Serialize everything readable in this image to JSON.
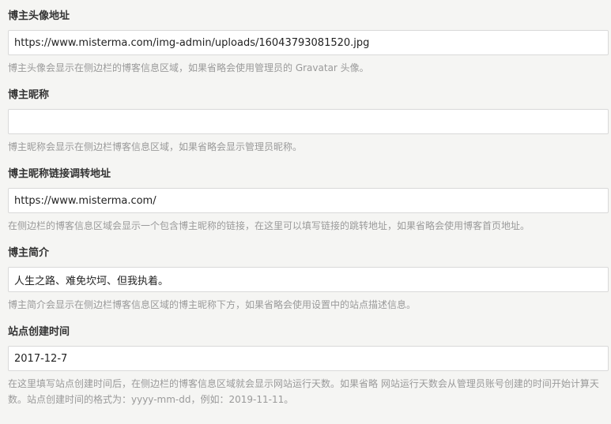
{
  "fields": [
    {
      "label": "博主头像地址",
      "value": "https://www.misterma.com/img-admin/uploads/16043793081520.jpg",
      "help": "博主头像会显示在侧边栏的博客信息区域，如果省略会使用管理员的 Gravatar 头像。"
    },
    {
      "label": "博主昵称",
      "value": "",
      "help": "博主昵称会显示在侧边栏博客信息区域，如果省略会显示管理员昵称。"
    },
    {
      "label": "博主昵称链接调转地址",
      "value": "https://www.misterma.com/",
      "help": "在侧边栏的博客信息区域会显示一个包含博主昵称的链接，在这里可以填写链接的跳转地址，如果省略会使用博客首页地址。"
    },
    {
      "label": "博主简介",
      "value": "人生之路、难免坎坷、但我执着。",
      "help": "博主简介会显示在侧边栏博客信息区域的博主昵称下方，如果省略会使用设置中的站点描述信息。"
    },
    {
      "label": "站点创建时间",
      "value": "2017-12-7",
      "help": "在这里填写站点创建时间后，在侧边栏的博客信息区域就会显示网站运行天数。如果省略 网站运行天数会从管理员账号创建的时间开始计算天数。站点创建时间的格式为：yyyy-mm-dd，例如：2019-11-11。"
    }
  ]
}
